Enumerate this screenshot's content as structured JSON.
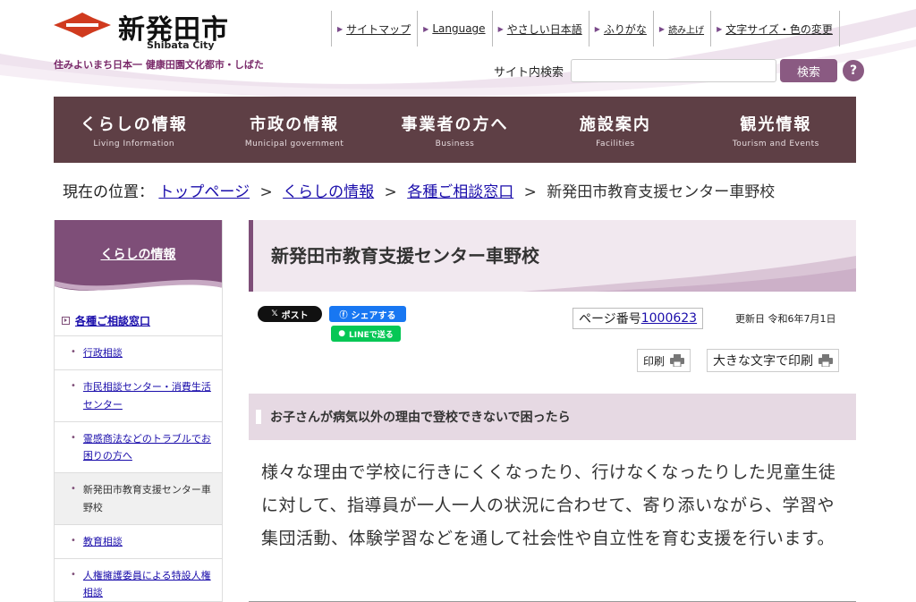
{
  "header": {
    "site_name": "新発田市",
    "site_name_en": "Shibata City",
    "tagline": "住みよいまち日本一 健康田園文化都市・しばた",
    "utility_links": [
      {
        "label": "サイトマップ"
      },
      {
        "label": "Language"
      },
      {
        "label": "やさしい日本語"
      },
      {
        "label": "ふりがな"
      },
      {
        "label": "読み上げ"
      },
      {
        "label": "文字サイズ・色の変更"
      }
    ],
    "search": {
      "label": "サイト内検索",
      "value": "",
      "button": "検索",
      "help": "?"
    }
  },
  "global_nav": [
    {
      "jp": "くらしの情報",
      "en": "Living Information"
    },
    {
      "jp": "市政の情報",
      "en": "Municipal government"
    },
    {
      "jp": "事業者の方へ",
      "en": "Business"
    },
    {
      "jp": "施設案内",
      "en": "Facilities"
    },
    {
      "jp": "観光情報",
      "en": "Tourism and Events"
    }
  ],
  "breadcrumb": {
    "label": "現在の位置：",
    "items": [
      "トップページ",
      "くらしの情報",
      "各種ご相談窓口"
    ],
    "current": "新発田市教育支援センター車野校",
    "separator": ">"
  },
  "sidebar": {
    "heading": "くらしの情報",
    "category": "各種ご相談窓口",
    "items": [
      {
        "label": "行政相談"
      },
      {
        "label": "市民相談センター・消費生活センター"
      },
      {
        "label": "霊感商法などのトラブルでお困りの方へ"
      },
      {
        "label": "新発田市教育支援センター車野校"
      },
      {
        "label": "教育相談"
      },
      {
        "label": "人権擁護委員による特設人権相談"
      }
    ]
  },
  "main": {
    "title": "新発田市教育支援センター車野校",
    "sns": {
      "x": "ポスト",
      "facebook": "シェアする",
      "line": "LINEで送る"
    },
    "page_number_label": "ページ番号",
    "page_number": "1000623",
    "updated": "更新日 令和6年7月1日",
    "print": "印刷",
    "print_large": "大きな文字で印刷",
    "section_heading": "お子さんが病気以外の理由で登校できないで困ったら",
    "body": "様々な理由で学校に行きにくくなったり、行けなくなったりした児童生徒に対して、指導員が一人一人の状況に合わせて、寄り添いながら、学習や集団活動、体験学習などを通して社会性や自立性を育む支援を行います。"
  },
  "colors": {
    "brand_purple": "#7e4e78",
    "nav_bg": "#5e3f45",
    "logo_red": "#d03a1e"
  }
}
